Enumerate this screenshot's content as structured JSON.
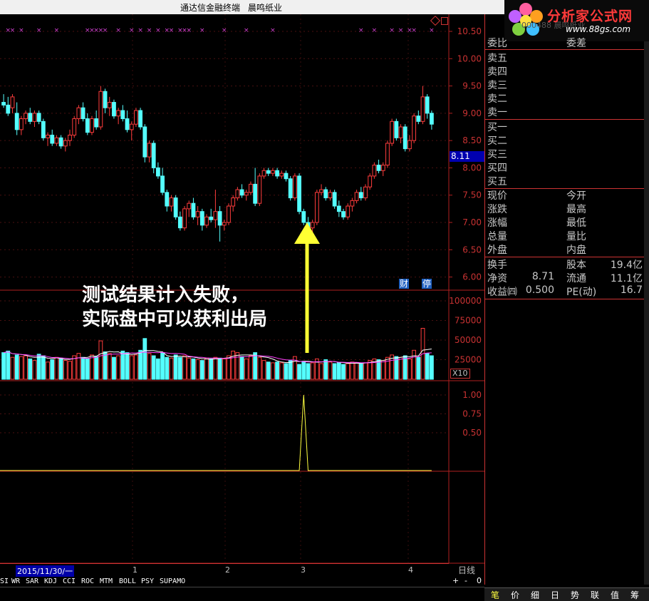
{
  "window": {
    "app_name": "通达信金融终端",
    "stock_name": "晨鸣纸业"
  },
  "logo": {
    "text": "分析家公式网",
    "url": "www.88gs.com",
    "faint_text": "000488 晨鸣纸业"
  },
  "price_axis": [
    "10.50",
    "10.00",
    "9.50",
    "9.00",
    "8.50",
    "8.00",
    "7.50",
    "7.00",
    "6.50",
    "6.00"
  ],
  "current_price_tag": "8.11",
  "volume_axis": [
    "100000",
    "75000",
    "50000",
    "25000"
  ],
  "volume_unit": "X10",
  "indicator_axis": [
    "1.00",
    "0.75",
    "0.50"
  ],
  "markers": {
    "cai": "财",
    "ting": "停"
  },
  "annotation": {
    "line1": "测试结果计入失败，",
    "line2": "实际盘中可以获利出局"
  },
  "date_axis": {
    "start": "2015/11/30/一",
    "months": [
      "1",
      "2",
      "3",
      "4"
    ],
    "period": "日线"
  },
  "indicator_tabs": [
    "SI",
    "WR",
    "SAR",
    "KDJ",
    "CCI",
    "ROC",
    "MTM",
    "BOLL",
    "PSY",
    "SUPAMO"
  ],
  "zoom_buttons": [
    "+",
    "-",
    "0"
  ],
  "quote_panel": {
    "header": {
      "left": "委比",
      "right": "委差"
    },
    "sell": [
      "卖五",
      "卖四",
      "卖三",
      "卖二",
      "卖一"
    ],
    "buy": [
      "买一",
      "买二",
      "买三",
      "买四",
      "买五"
    ],
    "stats": [
      {
        "l": "现价",
        "r": "今开"
      },
      {
        "l": "涨跌",
        "r": "最高"
      },
      {
        "l": "涨幅",
        "r": "最低"
      },
      {
        "l": "总量",
        "r": "量比"
      },
      {
        "l": "外盘",
        "r": "内盘"
      }
    ],
    "fund": [
      {
        "l": "换手",
        "lv": "",
        "r": "股本",
        "rv": "19.4亿"
      },
      {
        "l": "净资",
        "lv": "8.71",
        "r": "流通",
        "rv": "11.1亿"
      },
      {
        "l": "收益㈣",
        "lv": "0.500",
        "r": "PE(动)",
        "rv": "16.7"
      }
    ]
  },
  "status_tabs": [
    "笔",
    "价",
    "细",
    "日",
    "势",
    "联",
    "值",
    "筹"
  ],
  "chart_data": {
    "type": "candlestick",
    "price_range": [
      6.0,
      10.5
    ],
    "candles": [
      [
        9.2,
        9.35,
        9.1,
        9.15
      ],
      [
        9.15,
        9.3,
        8.95,
        9.0
      ],
      [
        9.1,
        9.35,
        9.0,
        9.3
      ],
      [
        9.0,
        9.2,
        8.6,
        8.7
      ],
      [
        8.7,
        8.95,
        8.6,
        8.9
      ],
      [
        8.9,
        9.05,
        8.8,
        9.0
      ],
      [
        9.0,
        9.1,
        8.8,
        8.85
      ],
      [
        8.85,
        9.05,
        8.75,
        9.0
      ],
      [
        9.0,
        9.05,
        8.8,
        8.85
      ],
      [
        8.85,
        8.9,
        8.5,
        8.55
      ],
      [
        8.55,
        8.65,
        8.4,
        8.6
      ],
      [
        8.6,
        8.7,
        8.4,
        8.45
      ],
      [
        8.45,
        8.6,
        8.4,
        8.55
      ],
      [
        8.55,
        8.6,
        8.35,
        8.4
      ],
      [
        8.4,
        8.55,
        8.3,
        8.5
      ],
      [
        8.5,
        8.7,
        8.4,
        8.6
      ],
      [
        8.6,
        8.95,
        8.55,
        8.9
      ],
      [
        8.9,
        9.15,
        8.8,
        9.1
      ],
      [
        9.1,
        9.2,
        8.85,
        8.9
      ],
      [
        8.9,
        9.0,
        8.6,
        8.65
      ],
      [
        8.65,
        8.95,
        8.6,
        8.9
      ],
      [
        8.9,
        9.05,
        8.7,
        8.75
      ],
      [
        8.75,
        9.5,
        8.7,
        9.4
      ],
      [
        9.4,
        9.45,
        9.0,
        9.1
      ],
      [
        9.1,
        9.3,
        8.95,
        9.2
      ],
      [
        9.2,
        9.25,
        8.9,
        8.95
      ],
      [
        8.95,
        9.1,
        8.8,
        9.05
      ],
      [
        9.05,
        9.15,
        8.85,
        8.9
      ],
      [
        8.9,
        9.05,
        8.65,
        8.7
      ],
      [
        8.7,
        8.85,
        8.5,
        8.8
      ],
      [
        8.8,
        9.1,
        8.75,
        9.05
      ],
      [
        9.05,
        9.1,
        8.7,
        8.75
      ],
      [
        8.75,
        8.8,
        8.1,
        8.2
      ],
      [
        8.2,
        8.5,
        8.1,
        8.45
      ],
      [
        8.45,
        8.5,
        7.9,
        8.0
      ],
      [
        8.0,
        8.1,
        7.8,
        7.85
      ],
      [
        7.85,
        8.0,
        7.5,
        7.55
      ],
      [
        7.55,
        7.6,
        7.2,
        7.3
      ],
      [
        7.3,
        7.5,
        7.2,
        7.45
      ],
      [
        7.45,
        7.5,
        7.05,
        7.1
      ],
      [
        7.1,
        7.2,
        6.85,
        6.9
      ],
      [
        6.9,
        7.3,
        6.85,
        7.25
      ],
      [
        7.25,
        7.4,
        7.1,
        7.35
      ],
      [
        7.35,
        7.45,
        7.05,
        7.1
      ],
      [
        7.1,
        7.3,
        6.95,
        7.2
      ],
      [
        7.2,
        7.25,
        6.85,
        6.95
      ],
      [
        6.95,
        7.15,
        6.9,
        7.1
      ],
      [
        7.1,
        7.25,
        7.0,
        7.05
      ],
      [
        7.05,
        7.6,
        6.9,
        7.2
      ],
      [
        7.2,
        7.3,
        6.65,
        6.95
      ],
      [
        6.95,
        7.05,
        6.85,
        7.0
      ],
      [
        7.0,
        7.35,
        6.95,
        7.3
      ],
      [
        7.3,
        7.5,
        7.2,
        7.45
      ],
      [
        7.45,
        7.65,
        7.4,
        7.6
      ],
      [
        7.6,
        7.7,
        7.45,
        7.5
      ],
      [
        7.5,
        7.6,
        7.4,
        7.55
      ],
      [
        7.55,
        7.75,
        7.5,
        7.7
      ],
      [
        7.7,
        8.0,
        7.3,
        7.35
      ],
      [
        7.35,
        7.9,
        7.3,
        7.85
      ],
      [
        7.85,
        8.0,
        7.8,
        7.95
      ],
      [
        7.95,
        8.0,
        7.85,
        7.9
      ],
      [
        7.9,
        8.0,
        7.85,
        7.95
      ],
      [
        7.95,
        8.0,
        7.8,
        7.85
      ],
      [
        7.85,
        7.95,
        7.8,
        7.9
      ],
      [
        7.9,
        7.95,
        7.75,
        7.8
      ],
      [
        7.8,
        7.85,
        7.4,
        7.45
      ],
      [
        7.45,
        7.9,
        7.4,
        7.85
      ],
      [
        7.85,
        7.9,
        7.15,
        7.2
      ],
      [
        7.2,
        7.25,
        6.95,
        7.0
      ],
      [
        7.0,
        7.1,
        6.85,
        6.9
      ],
      [
        6.9,
        7.05,
        6.8,
        7.0
      ],
      [
        7.0,
        7.6,
        6.95,
        7.55
      ],
      [
        7.55,
        7.7,
        7.5,
        7.6
      ],
      [
        7.6,
        7.65,
        7.4,
        7.45
      ],
      [
        7.45,
        7.6,
        7.4,
        7.55
      ],
      [
        7.55,
        7.6,
        7.25,
        7.3
      ],
      [
        7.3,
        7.4,
        7.1,
        7.2
      ],
      [
        7.2,
        7.25,
        7.05,
        7.1
      ],
      [
        7.1,
        7.35,
        7.05,
        7.3
      ],
      [
        7.3,
        7.45,
        7.2,
        7.4
      ],
      [
        7.4,
        7.6,
        7.35,
        7.55
      ],
      [
        7.55,
        7.65,
        7.4,
        7.45
      ],
      [
        7.45,
        7.7,
        7.4,
        7.65
      ],
      [
        7.65,
        7.9,
        7.6,
        7.85
      ],
      [
        7.85,
        8.1,
        7.8,
        8.05
      ],
      [
        8.05,
        8.15,
        7.9,
        7.95
      ],
      [
        7.95,
        8.1,
        7.85,
        8.05
      ],
      [
        8.05,
        8.5,
        8.0,
        8.45
      ],
      [
        8.45,
        8.9,
        8.4,
        8.85
      ],
      [
        8.85,
        8.9,
        8.5,
        8.55
      ],
      [
        8.55,
        8.8,
        8.45,
        8.75
      ],
      [
        8.75,
        8.8,
        8.3,
        8.35
      ],
      [
        8.35,
        8.6,
        8.3,
        8.5
      ],
      [
        8.5,
        9.0,
        8.45,
        8.95
      ],
      [
        8.95,
        9.05,
        8.8,
        8.85
      ],
      [
        8.85,
        9.5,
        8.8,
        9.3
      ],
      [
        9.3,
        9.35,
        8.9,
        9.0
      ],
      [
        9.0,
        9.05,
        8.7,
        8.8
      ]
    ],
    "volume_range": [
      0,
      110000
    ],
    "volumes": [
      34000,
      36000,
      28000,
      31000,
      29000,
      30000,
      26000,
      24000,
      32000,
      30000,
      22000,
      25000,
      28000,
      27000,
      24000,
      23000,
      30000,
      33000,
      28000,
      26000,
      31000,
      29000,
      49000,
      35000,
      33000,
      28000,
      30000,
      36000,
      34000,
      30000,
      31000,
      37000,
      52000,
      33000,
      30000,
      26000,
      34000,
      28000,
      27000,
      31000,
      28000,
      30000,
      27000,
      26000,
      25000,
      24000,
      27000,
      26000,
      28000,
      27000,
      26000,
      30000,
      36000,
      34000,
      29000,
      26000,
      30000,
      34000,
      28000,
      24000,
      22000,
      21000,
      22000,
      21000,
      20000,
      24000,
      29000,
      19000,
      23000,
      20000,
      21000,
      26000,
      20000,
      25000,
      22000,
      20000,
      21000,
      19000,
      20000,
      22000,
      21000,
      20000,
      21000,
      24000,
      26000,
      25000,
      24000,
      28000,
      31000,
      29000,
      28000,
      30000,
      26000,
      37000,
      28000,
      65000,
      33000,
      30000
    ],
    "signal_range": [
      0,
      1.2
    ],
    "signal_peak_index": 68,
    "signal_peak_value": 1.0,
    "cross_marker_indices": [
      1,
      2,
      4,
      8,
      12,
      19,
      20,
      21,
      22,
      23,
      26,
      29,
      31,
      33,
      35,
      37,
      38,
      40,
      41,
      42,
      45,
      50,
      55,
      61,
      81,
      84,
      88,
      90,
      92,
      93,
      97
    ]
  }
}
